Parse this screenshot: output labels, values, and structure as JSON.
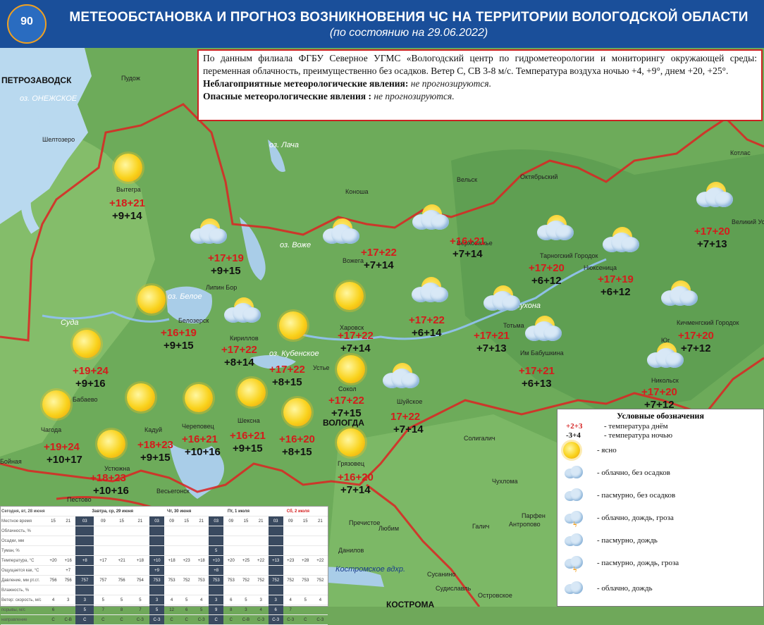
{
  "header": {
    "title": "МЕТЕООБСТАНОВКА И ПРОГНОЗ ВОЗНИКНОВЕНИЯ ЧС НА ТЕРРИТОРИИ ВОЛОГОДСКОЙ ОБЛАСТИ",
    "subtitle": "(по состоянию на 29.06.2022)",
    "logo_number": "90",
    "logo_text": "ГРАЖДАНСКОЙ ОБОРОНЕ"
  },
  "info": {
    "text": "По данным филиала ФГБУ Северное УГМС «Вологодский центр по гидрометеорологии и мониторингу окружающей среды: переменная облачность, преимущественно без осадков. Ветер С, СВ 3-8 м/с. Температура воздуха ночью +4, +9°, днем +20, +25°.",
    "adverse_label": "Неблагоприятные метеорологические явления:",
    "adverse_value": " не прогнозируются.",
    "dangerous_label": "Опасные метеорологические явления :",
    "dangerous_value": " не прогнозируются."
  },
  "places": [
    {
      "name": "ПЕТРОЗАВОДСК",
      "big": true
    },
    {
      "name": "оз. ОНЕЖСКОЕ",
      "lake": true
    },
    {
      "name": "Пудож"
    },
    {
      "name": "Шелтозеро"
    },
    {
      "name": "Вытегра"
    },
    {
      "name": "оз. Лача",
      "lake": true
    },
    {
      "name": "Коноша"
    },
    {
      "name": "Вельск"
    },
    {
      "name": "Октябрьский"
    },
    {
      "name": "Котлас"
    },
    {
      "name": "Великий Устюг"
    },
    {
      "name": "оз. Воже",
      "lake": true
    },
    {
      "name": "Вожега"
    },
    {
      "name": "Верховажье"
    },
    {
      "name": "Тарногский Городок"
    },
    {
      "name": "Нюксеница"
    },
    {
      "name": "Липин Бор"
    },
    {
      "name": "оз. Белое",
      "lake": true
    },
    {
      "name": "Белозерск"
    },
    {
      "name": "Кириллов"
    },
    {
      "name": "Харовск"
    },
    {
      "name": "Тотьма"
    },
    {
      "name": "Им Бабушкина"
    },
    {
      "name": "Кичменгский Городок"
    },
    {
      "name": "Юг"
    },
    {
      "name": "оз. Кубенское",
      "lake": true
    },
    {
      "name": "Устье"
    },
    {
      "name": "Сокол"
    },
    {
      "name": "Шуйское"
    },
    {
      "name": "Никольск"
    },
    {
      "name": "Бабаево"
    },
    {
      "name": "Чагода"
    },
    {
      "name": "Кадуй"
    },
    {
      "name": "Череповец"
    },
    {
      "name": "Шексна"
    },
    {
      "name": "ВОЛОГДА",
      "big": true
    },
    {
      "name": "Грязовец"
    },
    {
      "name": "Солигалич"
    },
    {
      "name": "Бойная"
    },
    {
      "name": "Устюжна"
    },
    {
      "name": "Пестово"
    },
    {
      "name": "Весьегонск"
    },
    {
      "name": "Чухлома"
    },
    {
      "name": "Пречистое"
    },
    {
      "name": "Любим"
    },
    {
      "name": "Галич"
    },
    {
      "name": "Антропово"
    },
    {
      "name": "Данилов"
    },
    {
      "name": "Костромское вдхр.",
      "lakeb": true
    },
    {
      "name": "Сусанино"
    },
    {
      "name": "Судиславль"
    },
    {
      "name": "Островское"
    },
    {
      "name": "КОСТРОМА",
      "big": true
    },
    {
      "name": "Суда",
      "lake": true
    },
    {
      "name": "Сухона",
      "lake": true
    },
    {
      "name": "Парфен"
    }
  ],
  "forecasts": [
    {
      "icon": "sun",
      "day": "+18+21",
      "night": "+9+14"
    },
    {
      "icon": "cloud",
      "day": "+17+19",
      "night": "+9+15"
    },
    {
      "icon": "cloud",
      "day": "+17+22",
      "night": "+7+14"
    },
    {
      "icon": "cloud",
      "day": "+16+21",
      "night": "+7+14"
    },
    {
      "icon": "cloud",
      "day": "+17+20",
      "night": "+6+12"
    },
    {
      "icon": "cloud",
      "day": "+17+19",
      "night": "+6+12"
    },
    {
      "icon": "cloud",
      "day": "+17+20",
      "night": "+7+13"
    },
    {
      "icon": "sun",
      "day": "+16+19",
      "night": "+9+15"
    },
    {
      "icon": "cloud",
      "day": "+17+22",
      "night": "+8+14"
    },
    {
      "icon": "sun",
      "day": "+17+22",
      "night": "+7+14"
    },
    {
      "icon": "cloud",
      "day": "+17+22",
      "night": "+6+14"
    },
    {
      "icon": "cloud",
      "day": "+17+21",
      "night": "+7+13"
    },
    {
      "icon": "cloud",
      "day": "+17+21",
      "night": "+6+13"
    },
    {
      "icon": "cloud",
      "day": "+17+20",
      "night": "+7+12"
    },
    {
      "icon": "sun",
      "day": "+19+24",
      "night": "+9+16"
    },
    {
      "icon": "sun",
      "day": "+17+22",
      "night": "+8+15"
    },
    {
      "icon": "sun",
      "day": "+17+22",
      "night": "+7+15"
    },
    {
      "icon": "cloud",
      "day": "17+22",
      "night": "+7+14"
    },
    {
      "icon": "cloud",
      "day": "+17+20",
      "night": "+7+12"
    },
    {
      "icon": "sun",
      "day": "+19+24",
      "night": "+10+17"
    },
    {
      "icon": "sun",
      "day": "+18+23",
      "night": "+9+15"
    },
    {
      "icon": "sun",
      "day": "+16+21",
      "night": "+10+16"
    },
    {
      "icon": "sun",
      "day": "+16+21",
      "night": "+9+15"
    },
    {
      "icon": "sun",
      "day": "+16+20",
      "night": "+8+15"
    },
    {
      "icon": "sun",
      "day": "+16+20",
      "night": "+7+14"
    },
    {
      "icon": "sun",
      "day": "+18+23",
      "night": "+10+16"
    },
    {
      "icon": "sun",
      "day": "",
      "night": ""
    }
  ],
  "legend": {
    "title": "Условные обозначения",
    "day_sample": "+2+3",
    "day_text": "- температура днём",
    "night_sample": "-3+4",
    "night_text": "- температура ночью",
    "items": [
      {
        "icon": "sun",
        "text": "- ясно"
      },
      {
        "icon": "partly",
        "text": "- облачно, без осадков"
      },
      {
        "icon": "overcast",
        "text": "- пасмурно, без осадков"
      },
      {
        "icon": "storm",
        "text": "- облачно, дождь, гроза"
      },
      {
        "icon": "rain",
        "text": "- пасмурно, дождь"
      },
      {
        "icon": "stormo",
        "text": "- пасмурно, дождь, гроза"
      },
      {
        "icon": "drizzle",
        "text": "- облачно, дождь"
      }
    ]
  },
  "table": {
    "days": [
      "Сегодня, вт, 28 июня",
      "Завтра, ср, 29 июня",
      "Чт, 30 июня",
      "Пт, 1 июля",
      "Сб, 2 июля"
    ],
    "rows": [
      {
        "label": "Местное время",
        "cells": [
          "15",
          "21",
          "03",
          "09",
          "15",
          "21",
          "03",
          "09",
          "15",
          "21",
          "03",
          "09",
          "15",
          "21",
          "03",
          "09",
          "15",
          "21"
        ]
      },
      {
        "label": "Облачность, %",
        "cells": [
          "",
          "",
          "",
          "",
          "",
          "",
          "",
          "",
          "",
          "",
          "",
          "",
          "",
          "",
          "",
          "",
          "",
          ""
        ]
      },
      {
        "label": "Осадки, мм",
        "cells": [
          "",
          "",
          "",
          "",
          "",
          "",
          "",
          "",
          "",
          "",
          "",
          "",
          "",
          "",
          "",
          "",
          "",
          ""
        ]
      },
      {
        "label": "Туман, %",
        "cells": [
          "",
          "",
          "",
          "",
          "",
          "",
          "",
          "",
          "",
          "",
          "5",
          "",
          "",
          "",
          "",
          "",
          "",
          ""
        ]
      },
      {
        "label": "Температура, °С",
        "cells": [
          "+20",
          "+16",
          "+8",
          "+17",
          "+21",
          "+18",
          "+10",
          "+18",
          "+23",
          "+18",
          "+10",
          "+20",
          "+25",
          "+22",
          "+13",
          "+23",
          "+28",
          "+22"
        ]
      },
      {
        "label": "Ощущается как, °С",
        "cells": [
          "",
          "+7",
          "",
          "",
          "",
          "",
          "+9",
          "",
          "",
          "",
          "+8",
          "",
          "",
          "",
          "",
          "",
          "",
          ""
        ]
      },
      {
        "label": "Давление, мм рт.ст.",
        "cells": [
          "756",
          "756",
          "757",
          "757",
          "756",
          "754",
          "753",
          "753",
          "752",
          "753",
          "753",
          "753",
          "752",
          "752",
          "752",
          "752",
          "753",
          "752"
        ]
      },
      {
        "label": "Влажность, %",
        "cells": [
          "",
          "",
          "",
          "",
          "",
          "",
          "",
          "",
          "",
          "",
          "",
          "",
          "",
          "",
          "",
          "",
          "",
          ""
        ]
      },
      {
        "label": "Ветер: скорость, м/с",
        "cells": [
          "4",
          "3",
          "3",
          "5",
          "5",
          "5",
          "3",
          "4",
          "5",
          "4",
          "3",
          "6",
          "5",
          "3",
          "3",
          "4",
          "5",
          "4"
        ]
      },
      {
        "label": "порывы, м/с",
        "cells": [
          "6",
          "",
          "5",
          "7",
          "8",
          "7",
          "5",
          "12",
          "6",
          "5",
          "9",
          "8",
          "3",
          "4",
          "6",
          "7",
          "",
          ""
        ]
      },
      {
        "label": "направление",
        "cells": [
          "С",
          "С-В",
          "С",
          "С",
          "С",
          "С-З",
          "С-З",
          "С",
          "С",
          "С-З",
          "С",
          "С",
          "С-В",
          "С-З",
          "С-З",
          "С-З",
          "С",
          "С-З"
        ]
      }
    ]
  },
  "colors": {
    "header": "#1a4f9a",
    "day": "#d41c1c",
    "night": "#111111",
    "border": "#c22222"
  }
}
